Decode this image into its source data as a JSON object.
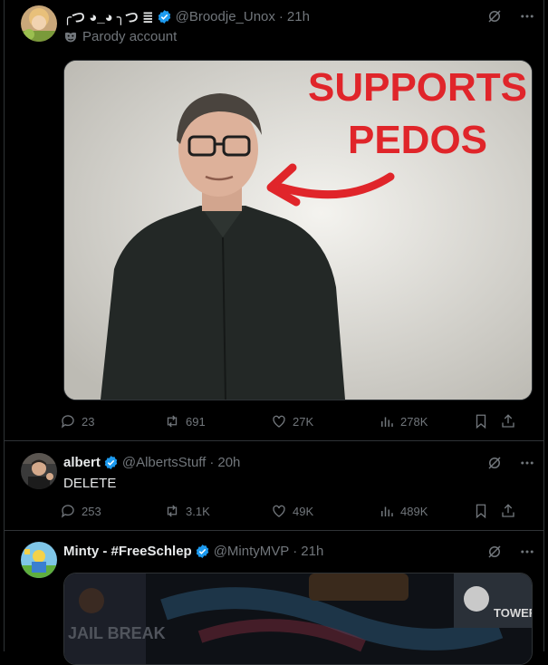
{
  "posts": [
    {
      "display_name": "╭つ ◕_◕ ╮つ ≣",
      "handle": "@Broodje_Unox",
      "dot": "·",
      "time": "21h",
      "parody_label": "Parody account",
      "media_text_line1": "SUPPORTS",
      "media_text_line2": "PEDOS",
      "replies": "23",
      "reposts": "691",
      "likes": "27K",
      "views": "278K"
    },
    {
      "display_name": "albert",
      "handle": "@AlbertsStuff",
      "dot": "·",
      "time": "20h",
      "text": "DELETE",
      "replies": "253",
      "reposts": "3.1K",
      "likes": "49K",
      "views": "489K"
    },
    {
      "display_name": "Minty - #FreeSchlep",
      "handle": "@MintyMVP",
      "dot": "·",
      "time": "21h",
      "media_text_left": "JAIL BREAK",
      "media_text_right": "TOWER HERO"
    }
  ],
  "colors": {
    "verified": "#1d9bf0",
    "meme_red": "#e0252a",
    "secondary_text": "#71767b",
    "divider": "#2f3336"
  },
  "icons": [
    "verified-badge-icon",
    "grok-icon",
    "more-icon",
    "reply-icon",
    "repost-icon",
    "like-icon",
    "views-icon",
    "bookmark-icon",
    "share-icon",
    "parody-mask-icon"
  ]
}
